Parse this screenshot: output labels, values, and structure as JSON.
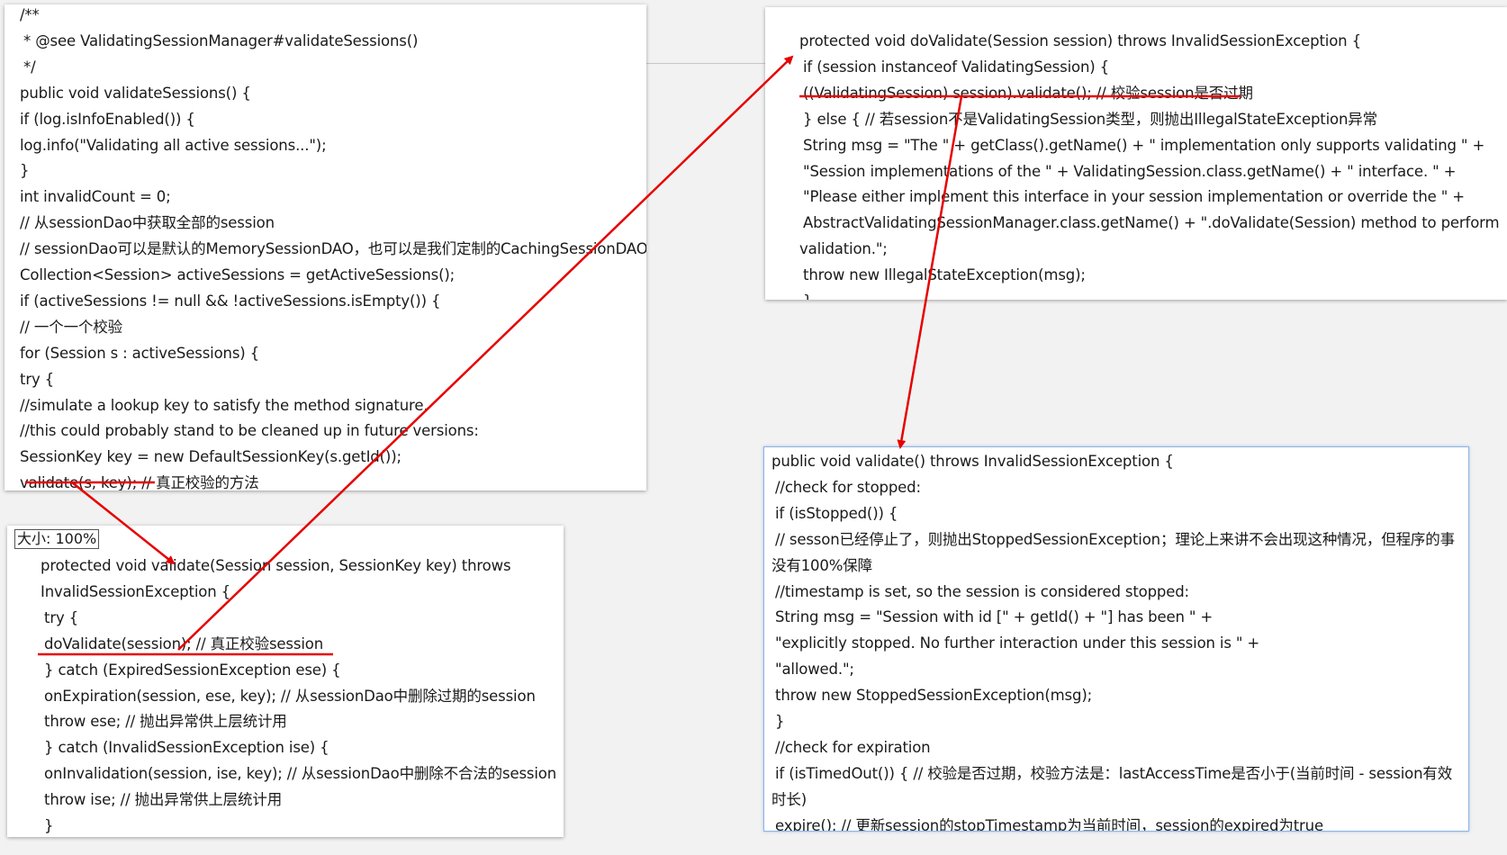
{
  "size_badge": "大小: 100%",
  "panel1": {
    "lines": [
      "/**",
      " * @see ValidatingSessionManager#validateSessions()",
      " */",
      "public void validateSessions() {",
      "if (log.isInfoEnabled()) {",
      "log.info(\"Validating all active sessions...\");",
      "}",
      "int invalidCount = 0;",
      "// 从sessionDao中获取全部的session",
      "// sessionDao可以是默认的MemorySessionDAO，也可以是我们定制的CachingSessionDAO",
      "Collection<Session> activeSessions = getActiveSessions();",
      "if (activeSessions != null && !activeSessions.isEmpty()) {",
      "// 一个一个校验",
      "for (Session s : activeSessions) {",
      "try {",
      "//simulate a lookup key to satisfy the method signature.",
      "//this could probably stand to be cleaned up in future versions:",
      "SessionKey key = new DefaultSessionKey(s.getId());",
      "validate(s, key); // 真正校验的方法"
    ]
  },
  "panel2": {
    "lines": [
      "protected void validate(Session session, SessionKey key) throws",
      "InvalidSessionException {",
      " try {",
      " doValidate(session); // 真正校验session",
      " } catch (ExpiredSessionException ese) {",
      " onExpiration(session, ese, key); // 从sessionDao中删除过期的session",
      " throw ese; // 抛出异常供上层统计用",
      " } catch (InvalidSessionException ise) {",
      " onInvalidation(session, ise, key); // 从sessionDao中删除不合法的session",
      " throw ise; // 抛出异常供上层统计用",
      " }"
    ]
  },
  "panel3": {
    "lines": [
      "protected void doValidate(Session session) throws InvalidSessionException {",
      " if (session instanceof ValidatingSession) {",
      " ((ValidatingSession) session).validate(); // 校验session是否过期",
      " } else { // 若session不是ValidatingSession类型，则抛出IllegalStateException异常",
      " String msg = \"The \" + getClass().getName() + \" implementation only supports validating \" +",
      " \"Session implementations of the \" + ValidatingSession.class.getName() + \" interface. \" +",
      " \"Please either implement this interface in your session implementation or override the \" +",
      " AbstractValidatingSessionManager.class.getName() + \".doValidate(Session) method to perform",
      "validation.\";",
      " throw new IllegalStateException(msg);",
      " }"
    ]
  },
  "panel4": {
    "lines": [
      "public void validate() throws InvalidSessionException {",
      " //check for stopped:",
      " if (isStopped()) {",
      " // sesson已经停止了，则抛出StoppedSessionException；理论上来讲不会出现这种情况，但程序的事",
      "没有100%保障",
      " //timestamp is set, so the session is considered stopped:",
      " String msg = \"Session with id [\" + getId() + \"] has been \" +",
      " \"explicitly stopped. No further interaction under this session is \" +",
      " \"allowed.\";",
      " throw new StoppedSessionException(msg);",
      " }",
      " //check for expiration",
      " if (isTimedOut()) { // 校验是否过期，校验方法是：lastAccessTime是否小于(当前时间 - session有效",
      "时长)",
      " expire(); // 更新session的stopTimestamp为当前时间，session的expired为true"
    ]
  },
  "annotation_color": "#e60000"
}
